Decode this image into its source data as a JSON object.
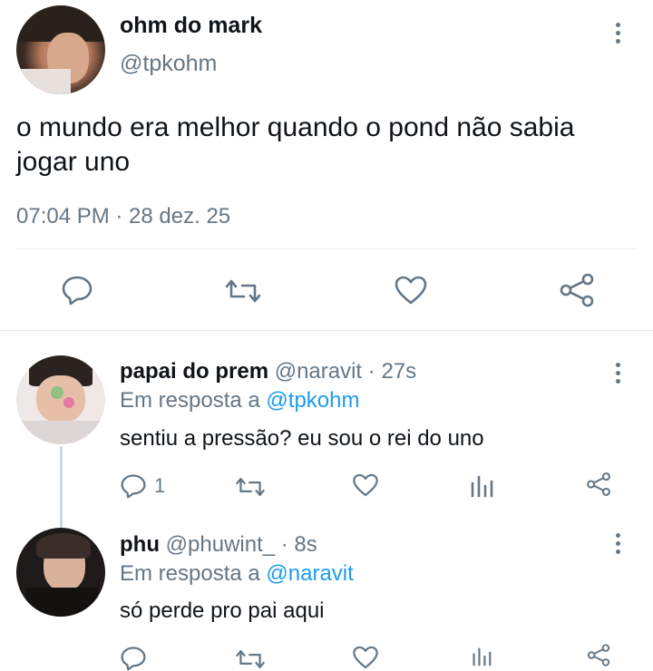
{
  "main_tweet": {
    "display_name": "ohm do mark",
    "handle": "@tpkohm",
    "text_line1": "o mundo era melhor quando o pond não sabia",
    "text_line2": "jogar uno",
    "timestamp": "07:04 PM · 28 dez. 25"
  },
  "replies": [
    {
      "display_name": "papai do prem",
      "handle": "@naravit",
      "time": "· 27s",
      "reply_prefix": "Em resposta a",
      "reply_to": "@tpkohm",
      "text": "sentiu a pressão? eu sou o rei do uno",
      "reply_count": "1"
    },
    {
      "display_name": "phu",
      "handle": "@phuwint_",
      "time": "· 8s",
      "reply_prefix": "Em resposta a",
      "reply_to": "@naravit",
      "text": "só perde pro pai aqui"
    }
  ],
  "icons": {
    "reply": "speech-bubble-icon",
    "retweet": "retweet-icon",
    "like": "heart-icon",
    "share": "share-icon",
    "analytics": "analytics-bars-icon",
    "more": "kebab-menu-icon"
  },
  "colors": {
    "text": "#0f1419",
    "secondary": "#657786",
    "link": "#1d9bf0",
    "divider": "#e6ecf0"
  }
}
